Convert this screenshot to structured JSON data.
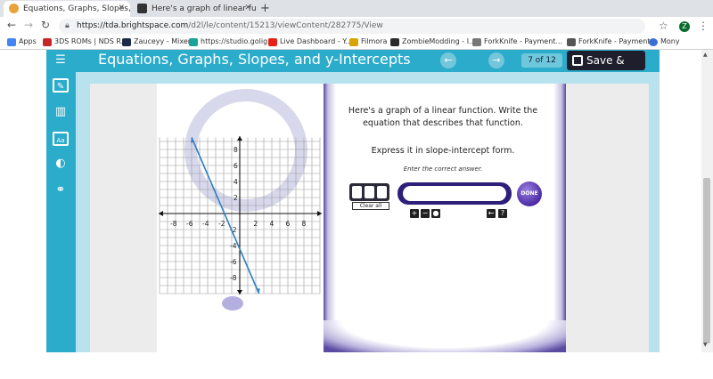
{
  "browser": {
    "tabs": [
      {
        "title": "Equations, Graphs, Slopes, and y-",
        "active": true
      },
      {
        "title": "Here's a graph of linear functio",
        "active": false
      }
    ],
    "url_host": "https://tda.brightspace.com",
    "url_path": "/d2l/le/content/15213/viewContent/282775/View",
    "avatar_letter": "Z",
    "bookmarks": [
      {
        "label": "Apps",
        "icon": "apps-grid-icon",
        "color": "#4285f4"
      },
      {
        "label": "3DS ROMs | NDS R...",
        "icon": "rom-site-icon",
        "color": "#c62828"
      },
      {
        "label": "Zauceyy - Mixer",
        "icon": "mixer-icon",
        "color": "#1c2a4a"
      },
      {
        "label": "https://studio.golig...",
        "icon": "studio-icon",
        "color": "#1aa39a"
      },
      {
        "label": "Live Dashboard - Y...",
        "icon": "youtube-icon",
        "color": "#e62117"
      },
      {
        "label": "Filmora",
        "icon": "filmora-icon",
        "color": "#d9a400"
      },
      {
        "label": "ZombieModding - I...",
        "icon": "zombiemodding-icon",
        "color": "#2b2b2b"
      },
      {
        "label": "ForkKnife - Payment...",
        "icon": "document-icon",
        "color": "#777777"
      },
      {
        "label": "ForkKnife - Payment...",
        "icon": "printer-icon",
        "color": "#555555"
      },
      {
        "label": "Mony",
        "icon": "globe-icon",
        "color": "#3b6fd6"
      }
    ]
  },
  "lesson": {
    "title": "Equations, Graphs, Slopes, and y-Intercepts: App",
    "page_current": "7",
    "page_of": "of",
    "page_total": "12",
    "save_exit": "Save & Exit",
    "accent": "#2caccb"
  },
  "question": {
    "prompt": "Here's a graph of a linear function. Write the equation that describes that function.",
    "instruction": "Express it in slope-intercept form.",
    "enter_hint": "Enter the correct answer.",
    "answer_value": "",
    "clear_label": "Clear all",
    "done_label": "DONE"
  },
  "graph": {
    "x_ticks": [
      "-8",
      "-6",
      "-4",
      "-2",
      "2",
      "4",
      "6",
      "8"
    ],
    "y_ticks": [
      "8",
      "6",
      "4",
      "2",
      "-2",
      "-4",
      "-6",
      "-8"
    ],
    "line_color": "#2f7fc2"
  }
}
